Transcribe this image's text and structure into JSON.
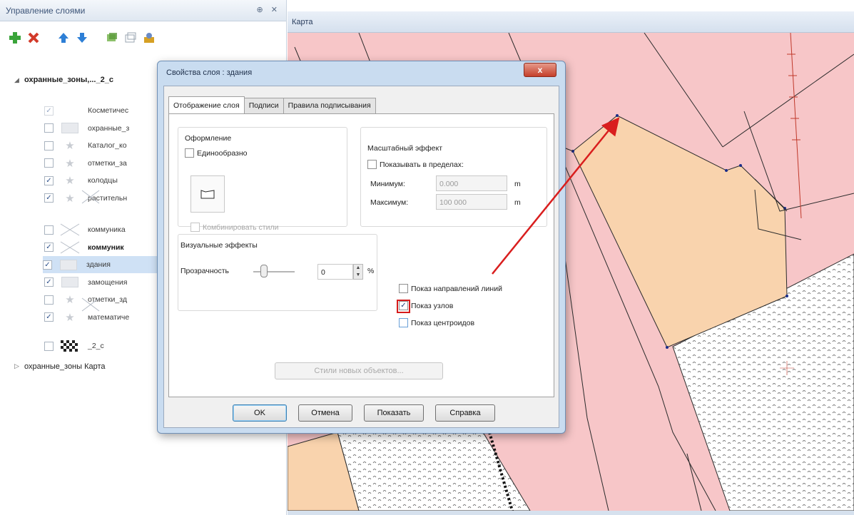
{
  "layers_panel": {
    "title": "Управление слоями",
    "header_buttons": "⊕ ✕",
    "toolbar": [
      {
        "icon": "add-layer-icon",
        "color": "#3aa43a"
      },
      {
        "icon": "delete-layer-icon",
        "color": "#d23a2a"
      },
      {
        "icon": "move-up-icon",
        "color": "#2d7fd6"
      },
      {
        "icon": "move-down-icon",
        "color": "#2d7fd6"
      },
      {
        "icon": "layer-properties-icon",
        "color": "#5a9a3a"
      },
      {
        "icon": "group-icon",
        "color": "#9aa4b0"
      },
      {
        "icon": "user-settings-icon",
        "color": "#d6a024"
      }
    ],
    "groups": [
      {
        "label": "охранные_зоны,..._2_с",
        "expanded": true
      },
      {
        "label": "охранные_зоны Карта",
        "expanded": false
      }
    ],
    "layers": [
      {
        "name": "Косметичес",
        "checked": true,
        "dim": true,
        "icon": "none",
        "bold": false
      },
      {
        "name": "охранные_з",
        "checked": false,
        "dim": false,
        "icon": "rect",
        "bold": false
      },
      {
        "name": "Каталог_ко",
        "checked": false,
        "dim": false,
        "icon": "star",
        "bold": false
      },
      {
        "name": "отметки_за",
        "checked": false,
        "dim": false,
        "icon": "star",
        "bold": false
      },
      {
        "name": "колодцы",
        "checked": true,
        "dim": false,
        "icon": "star",
        "bold": false
      },
      {
        "name": "растительн",
        "checked": true,
        "dim": false,
        "icon": "star",
        "bold": false
      },
      {
        "name": "коммуника",
        "checked": false,
        "dim": false,
        "icon": "cross",
        "bold": false
      },
      {
        "name": "коммуник",
        "checked": true,
        "dim": false,
        "icon": "cross",
        "bold": true
      },
      {
        "name": "здания",
        "checked": true,
        "dim": false,
        "icon": "rect",
        "bold": false,
        "selected": true
      },
      {
        "name": "замощения",
        "checked": true,
        "dim": false,
        "icon": "rect",
        "bold": false
      },
      {
        "name": "отметки_зд",
        "checked": false,
        "dim": false,
        "icon": "star",
        "bold": false
      },
      {
        "name": "математиче",
        "checked": true,
        "dim": false,
        "icon": "star",
        "bold": false
      },
      {
        "name": "_2_с",
        "checked": false,
        "dim": false,
        "icon": "checker",
        "bold": false
      }
    ]
  },
  "map": {
    "title": "Карта",
    "colors": {
      "zone": "#f7c6c8",
      "building": "#f9d3ad",
      "hatch": "#ffffff",
      "line": "#2b2b2b",
      "arrow": "#d91e1e"
    }
  },
  "dialog": {
    "title": "Свойства слоя : здания",
    "close_label": "x",
    "tabs": [
      {
        "label": "Отображение слоя",
        "active": true
      },
      {
        "label": "Подписи",
        "active": false
      },
      {
        "label": "Правила подписывания",
        "active": false
      }
    ],
    "appearance": {
      "group_label": "Оформление",
      "uniform_label": "Единообразно",
      "uniform_checked": false,
      "combine_styles_label": "Комбинировать стили"
    },
    "scale": {
      "group_label": "Масштабный эффект",
      "show_in_range_label": "Показывать в пределах:",
      "min_label": "Минимум:",
      "min_value": "0.000",
      "max_label": "Максимум:",
      "max_value": "100 000",
      "unit": "m"
    },
    "visual": {
      "group_label": "Визуальные эффекты",
      "transparency_label": "Прозрачность",
      "transparency_value": "0",
      "transparency_unit": "%",
      "transparency_level": 0
    },
    "display": {
      "show_line_direction": "Показ направлений линий",
      "show_line_direction_checked": false,
      "show_nodes": "Показ узлов",
      "show_nodes_checked": true,
      "show_centroids": "Показ центроидов",
      "show_centroids_checked": false
    },
    "new_objects_style_label": "Стили новых объектов...",
    "buttons": {
      "ok": "OK",
      "cancel": "Отмена",
      "show": "Показать",
      "help": "Справка"
    }
  }
}
